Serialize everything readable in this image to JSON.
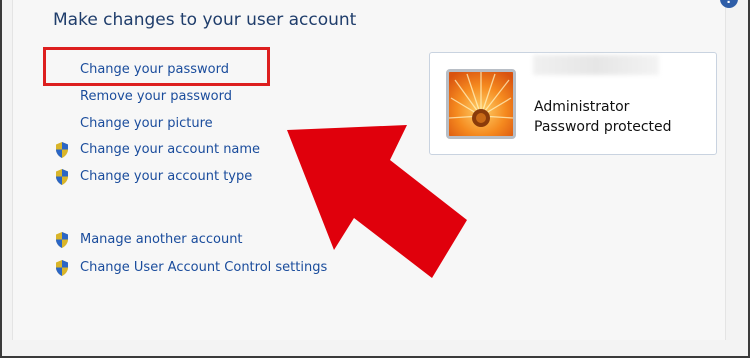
{
  "page": {
    "title": "Make changes to your user account"
  },
  "tasks": [
    {
      "label": "Change your password",
      "shield": false
    },
    {
      "label": "Remove your password",
      "shield": false
    },
    {
      "label": "Change your picture",
      "shield": false
    },
    {
      "label": "Change your account name",
      "shield": true
    },
    {
      "label": "Change your account type",
      "shield": true
    },
    {
      "label": "Manage another account",
      "shield": true
    },
    {
      "label": "Change User Account Control settings",
      "shield": true
    }
  ],
  "account": {
    "name": "Administrator",
    "status": "Password protected",
    "picture": "orange-flower"
  },
  "annotations": {
    "highlight_color": "#dd1f1f",
    "arrow_color": "#e0000c"
  },
  "icons": {
    "shield": "uac-shield-icon",
    "help": "help-icon"
  }
}
